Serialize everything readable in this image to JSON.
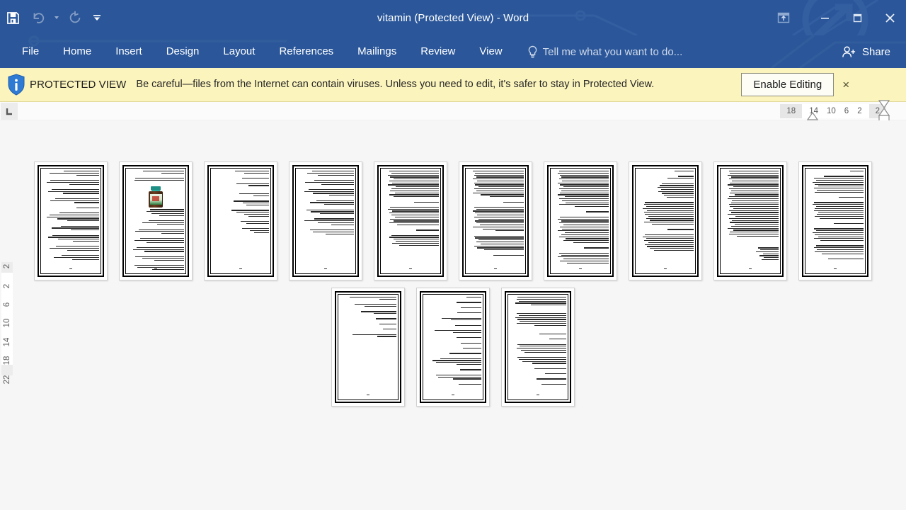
{
  "window": {
    "title": "vitamin (Protected View) - Word",
    "accent_color": "#2b579a",
    "quick_access": [
      {
        "name": "save-button",
        "label": "Save",
        "enabled": true
      },
      {
        "name": "undo-button",
        "label": "Undo",
        "enabled": false
      },
      {
        "name": "redo-button",
        "label": "Repeat",
        "enabled": false
      },
      {
        "name": "customize-quick-access-toolbar",
        "label": "Customize Quick Access Toolbar",
        "enabled": true
      }
    ],
    "controls": [
      {
        "name": "ribbon-display-options",
        "label": "Ribbon Display Options"
      },
      {
        "name": "minimize-button",
        "label": "Minimize"
      },
      {
        "name": "restore-button",
        "label": "Restore Down"
      },
      {
        "name": "close-button",
        "label": "Close"
      }
    ]
  },
  "ribbon": {
    "tabs": [
      {
        "label": "File",
        "active": false
      },
      {
        "label": "Home",
        "active": false
      },
      {
        "label": "Insert",
        "active": false
      },
      {
        "label": "Design",
        "active": false
      },
      {
        "label": "Layout",
        "active": false
      },
      {
        "label": "References",
        "active": false
      },
      {
        "label": "Mailings",
        "active": false
      },
      {
        "label": "Review",
        "active": false
      },
      {
        "label": "View",
        "active": true
      }
    ],
    "tellme_placeholder": "Tell me what you want to do...",
    "share_label": "Share"
  },
  "protected_view": {
    "badge": "PROTECTED VIEW",
    "message": "Be careful—files from the Internet can contain viruses. Unless you need to edit, it's safer to stay in Protected View.",
    "enable_button": "Enable Editing",
    "close_label": "×",
    "background_color": "#fcf4bd"
  },
  "rulers": {
    "tab_stop_selector": "left-tab-stop",
    "horizontal_numbers": [
      "18",
      "14",
      "10",
      "6",
      "2",
      "2"
    ],
    "vertical_numbers": [
      "2",
      "2",
      "6",
      "10",
      "14",
      "18",
      "22"
    ],
    "direction": "right-to-left"
  },
  "document": {
    "view_mode": "Multiple Pages",
    "total_pages": 13,
    "pages": [
      {
        "number": 1,
        "has_image": false,
        "lines": [
          62,
          88,
          40,
          0,
          86,
          92,
          52,
          0,
          84,
          90,
          64,
          0,
          78,
          86,
          44,
          0,
          40,
          0,
          70,
          88,
          92,
          74,
          56,
          0,
          68,
          84,
          50,
          0,
          82,
          90,
          72,
          46,
          0,
          76,
          88,
          56,
          0,
          66,
          80,
          48
        ]
      },
      {
        "number": 2,
        "has_image": true,
        "lines": [
          72,
          40,
          0,
          86,
          88,
          0,
          "IMG",
          60,
          66,
          58,
          44,
          0,
          62,
          74,
          48,
          0,
          80,
          86,
          40,
          0,
          78,
          88,
          66,
          0,
          84,
          90,
          70,
          0,
          86,
          74,
          52,
          0,
          88,
          82,
          56
        ]
      },
      {
        "number": 3,
        "has_image": false,
        "lines": [
          60,
          44,
          0,
          48,
          0,
          58,
          36,
          0,
          0,
          52,
          28,
          0,
          62,
          46,
          40,
          0,
          66,
          58,
          44,
          36,
          0,
          50,
          40,
          0,
          48,
          34,
          26
        ]
      },
      {
        "number": 4,
        "has_image": false,
        "lines": [
          74,
          82,
          64,
          0,
          70,
          86,
          58,
          0,
          80,
          88,
          72,
          44,
          0,
          66,
          78,
          52,
          0,
          84,
          76,
          60,
          0,
          70,
          88,
          64,
          40,
          0,
          78,
          72,
          50
        ]
      },
      {
        "number": 5,
        "has_image": false,
        "lines": [
          88,
          84,
          90,
          86,
          80,
          88,
          82,
          90,
          76,
          84,
          86,
          78,
          88,
          80,
          0,
          44,
          0,
          86,
          90,
          82,
          88,
          84,
          78,
          86,
          80,
          88,
          74,
          0,
          40,
          0,
          84,
          88,
          80,
          76,
          82,
          70
        ]
      },
      {
        "number": 6,
        "has_image": false,
        "lines": [
          90,
          86,
          88,
          84,
          90,
          82,
          88,
          86,
          80,
          88,
          84,
          90,
          76,
          60,
          0,
          36,
          0,
          88,
          84,
          90,
          86,
          82,
          88,
          80,
          86,
          84,
          78,
          90,
          72,
          50,
          0,
          88,
          86,
          80,
          84,
          76,
          88,
          82,
          70,
          0,
          54
        ]
      },
      {
        "number": 7,
        "has_image": false,
        "lines": [
          88,
          90,
          86,
          84,
          88,
          82,
          90,
          86,
          80,
          88,
          84,
          86,
          90,
          78,
          88,
          82,
          76,
          88,
          60,
          0,
          40,
          0,
          86,
          90,
          84,
          88,
          80,
          86,
          82,
          90,
          78,
          84,
          88,
          76,
          80,
          62,
          0,
          44,
          0,
          88,
          84,
          90,
          80,
          86,
          74
        ]
      },
      {
        "number": 8,
        "has_image": false,
        "lines": [
          34,
          0,
          28,
          46,
          0,
          56,
          60,
          64,
          58,
          62,
          56,
          52,
          48,
          0,
          86,
          88,
          84,
          90,
          82,
          88,
          86,
          80,
          84,
          78,
          88,
          74,
          0,
          46,
          0,
          86,
          90,
          84,
          88,
          80,
          86,
          82,
          78,
          70
        ]
      },
      {
        "number": 9,
        "has_image": false,
        "lines": [
          88,
          86,
          90,
          84,
          88,
          82,
          86,
          90,
          80,
          88,
          84,
          86,
          78,
          88,
          90,
          82,
          84,
          88,
          86,
          80,
          88,
          84,
          90,
          76,
          88,
          82,
          86,
          78,
          84,
          90,
          80,
          86,
          88,
          74,
          0,
          0,
          0,
          36,
          32,
          40,
          28,
          34,
          26,
          30
        ]
      },
      {
        "number": 10,
        "has_image": false,
        "lines": [
          24,
          0,
          70,
          88,
          84,
          90,
          86,
          80,
          88,
          82,
          86,
          0,
          44,
          0,
          88,
          90,
          84,
          86,
          88,
          80,
          82,
          86,
          78,
          0,
          52,
          0,
          88,
          84,
          90,
          86,
          80,
          88,
          76,
          0,
          84,
          88,
          82,
          86,
          74,
          0,
          62
        ]
      },
      {
        "number": 11,
        "has_image": false,
        "lines": [
          82,
          30,
          0,
          74,
          56,
          0,
          62,
          40,
          0,
          36,
          0,
          30,
          0,
          24,
          0,
          78,
          34
        ]
      },
      {
        "number": 12,
        "has_image": false,
        "lines": [
          26,
          0,
          44,
          0,
          36,
          0,
          42,
          0,
          70,
          54,
          0,
          46,
          0,
          82,
          50,
          0,
          44,
          0,
          36,
          0,
          32,
          0,
          56,
          0,
          72,
          86,
          80,
          44,
          0,
          38,
          0,
          80,
          76,
          50,
          0,
          40
        ]
      },
      {
        "number": 13,
        "has_image": false,
        "lines": [
          86,
          88,
          84,
          90,
          62,
          0,
          0,
          88,
          84,
          90,
          86,
          82,
          88,
          56,
          0,
          0,
          48,
          0,
          30,
          0,
          86,
          82,
          88,
          80,
          74,
          0,
          86,
          84,
          78,
          60,
          0,
          56,
          0,
          38,
          0,
          52,
          0,
          44
        ]
      }
    ]
  }
}
